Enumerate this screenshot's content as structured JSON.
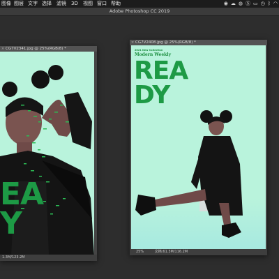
{
  "menubar": {
    "items": [
      "图像",
      "图层",
      "文字",
      "选择",
      "滤镜",
      "3D",
      "视图",
      "窗口",
      "帮助"
    ],
    "right_icons": [
      "wechat-icon",
      "cloud-icon",
      "chat-icon",
      "s-icon",
      "display-icon",
      "clock-icon",
      "bluetooth-icon",
      "wifi-icon"
    ]
  },
  "window": {
    "title": "Adobe Photoshop CC 2019"
  },
  "doc_left": {
    "tab": "CG7V2341.jpg @ 25%(RGB/8) *",
    "status_size": "1.3M/123.2M",
    "cover_word_a": "EA",
    "cover_word_b": "Y"
  },
  "doc_right": {
    "tab": "CG7V2408.jpg @ 25%(RGB/8) *",
    "zoom": "25%",
    "status_label": "文档:61.3M/116.2M",
    "collection": "2021 New Collection",
    "magazine": "Modern Weekly",
    "word_line1": "REA",
    "word_line2": "DY"
  },
  "colors": {
    "canvas_bg": "#b9f3dc",
    "accent_green": "#1d9a45",
    "outfit": "#111111"
  }
}
